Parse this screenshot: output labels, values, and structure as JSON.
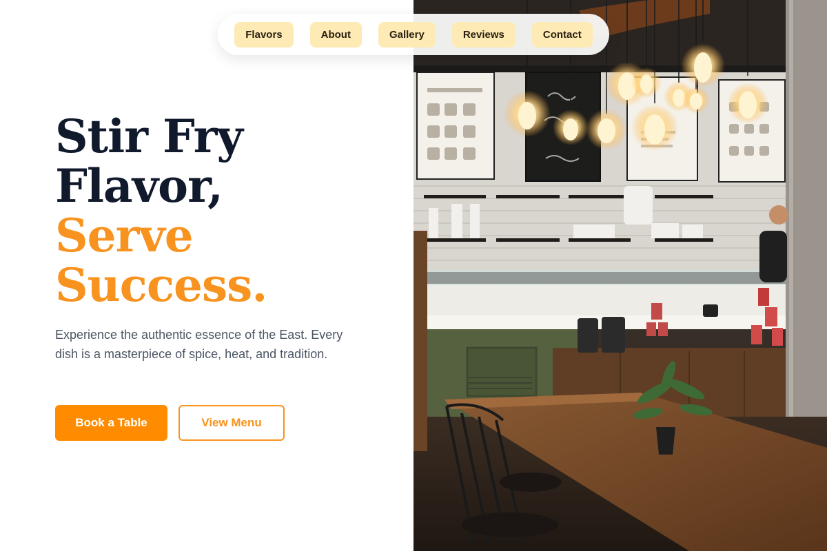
{
  "nav": {
    "items": [
      {
        "label": "Flavors"
      },
      {
        "label": "About"
      },
      {
        "label": "Gallery"
      },
      {
        "label": "Reviews"
      },
      {
        "label": "Contact"
      }
    ],
    "item_bg": "#fdeab4"
  },
  "hero": {
    "headline": {
      "line1": "Stir Fry",
      "line2": "Flavor,",
      "line3": "Serve",
      "line4": "Success."
    },
    "subtext": "Experience the authentic essence of the East. Every dish is a masterpiece of spice, heat, and tradition.",
    "primary_button": "Book a Table",
    "secondary_button": "View Menu"
  },
  "colors": {
    "accent": "#f7931e",
    "primary_button": "#ff8c00",
    "headline_dark": "#111a2c",
    "body_text": "#4b5563"
  },
  "photo": {
    "description_icon": "cafe-interior-photo"
  }
}
